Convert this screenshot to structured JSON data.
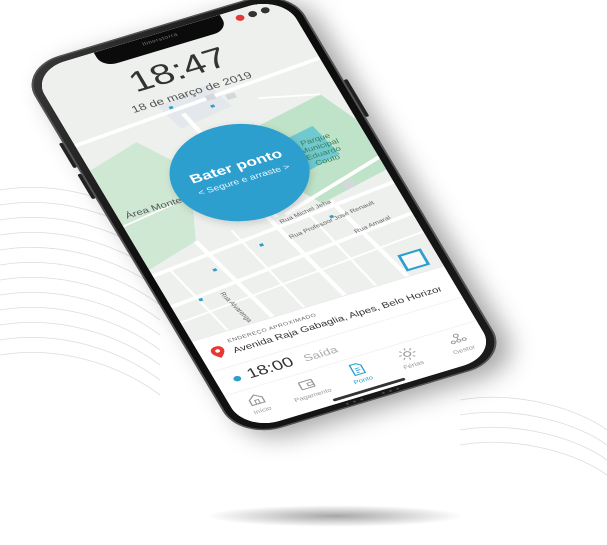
{
  "device": {
    "notch_text": "Ilmerstorra"
  },
  "lockscreen": {
    "time": "18:47",
    "date": "18 de março de 2019"
  },
  "map": {
    "labels": {
      "area": "Área Montese",
      "park": "Parque Municipal Eduardo Couto",
      "street1": "Rua Michel Jeha",
      "street2": "Rua Professor José Renault",
      "street3": "Rua Alvarenga",
      "street4": "Rua Amaral"
    },
    "colors": {
      "park": "#bfe3c8",
      "water": "#6fc9cf",
      "road": "#ffffff",
      "background": "#eef0ee"
    }
  },
  "punch_button": {
    "title": "Bater ponto",
    "subtitle": "< Segure e arraste >",
    "color": "#2c9fcf"
  },
  "address": {
    "label": "ENDEREÇO APROXIMADO",
    "text": "Avenida Raja Gabaglia, Alpes, Belo Horizonte, ..."
  },
  "last_punch": {
    "time": "18:00",
    "type": "Saída"
  },
  "nav": {
    "items": [
      {
        "label": "Início",
        "icon": "home-icon",
        "active": false
      },
      {
        "label": "Pagamento",
        "icon": "wallet-icon",
        "active": false
      },
      {
        "label": "Ponto",
        "icon": "document-icon",
        "active": true
      },
      {
        "label": "Férias",
        "icon": "sun-icon",
        "active": false
      },
      {
        "label": "Gestor",
        "icon": "team-icon",
        "active": false
      }
    ]
  },
  "accent_color": "#2c9fcf"
}
